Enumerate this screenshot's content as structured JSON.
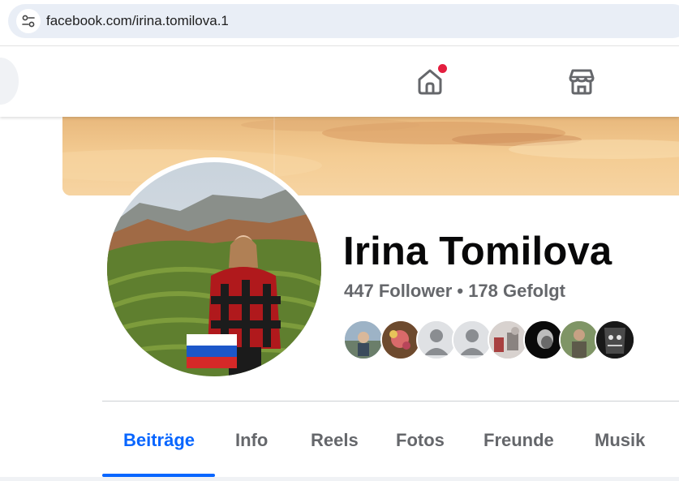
{
  "browser": {
    "url": "facebook.com/irina.tomilova.1"
  },
  "nav": {
    "icons": [
      "home-icon",
      "marketplace-icon"
    ],
    "home_has_notification": true,
    "notification_color": "#e41e3f"
  },
  "profile": {
    "name": "Irina Tomilova",
    "stats": "447 Follower • 178 Gefolgt"
  },
  "tabs": [
    {
      "label": "Beiträge",
      "active": true
    },
    {
      "label": "Info",
      "active": false
    },
    {
      "label": "Reels",
      "active": false
    },
    {
      "label": "Fotos",
      "active": false
    },
    {
      "label": "Freunde",
      "active": false
    },
    {
      "label": "Musik",
      "active": false
    }
  ],
  "colors": {
    "accent": "#0866ff",
    "secondary_text": "#65676b"
  }
}
